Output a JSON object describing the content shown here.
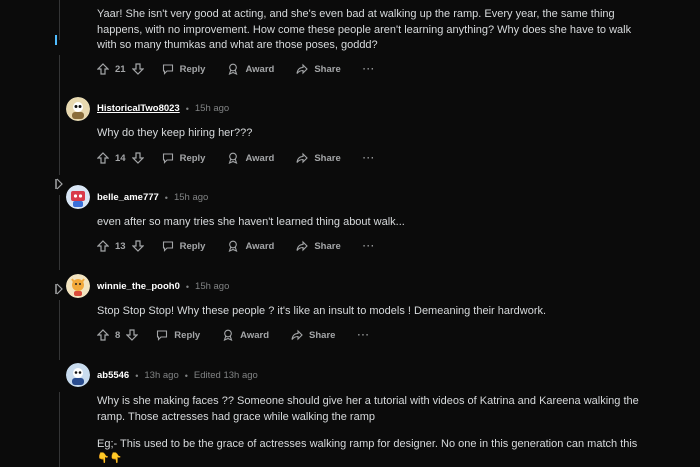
{
  "actions": {
    "reply": "Reply",
    "award": "Award",
    "share": "Share",
    "more": "···"
  },
  "comments": [
    {
      "text": "Yaar! She isn't very good at acting, and she's even bad at walking up the ramp. Every year, the same thing happens, with no improvement. How come these people aren't learning anything? Why does she have to walk with so many thumkas and what are those poses, goddd?",
      "votes": "21"
    },
    {
      "username": "HistoricalTwo8023",
      "time": "15h ago",
      "text": "Why do they keep hiring her???",
      "votes": "14"
    },
    {
      "username": "belle_ame777",
      "time": "15h ago",
      "text": "even after so many tries she haven't learned thing about walk...",
      "votes": "13"
    },
    {
      "username": "winnie_the_pooh0",
      "time": "15h ago",
      "text": "Stop Stop Stop! Why these people ? it's like an insult to models ! Demeaning their hardwork.",
      "votes": "8"
    },
    {
      "username": "ab5546",
      "time": "13h ago",
      "edited": "Edited 13h ago",
      "text": "Why is she making faces ?? Someone should give her a tutorial with videos of Katrina and Kareena walking the ramp. Those actresses had grace while walking the ramp",
      "text2": "Eg;- This used to be the grace of actresses walking ramp for designer. No one in this generation can match this",
      "emoji": "👇👇"
    }
  ]
}
